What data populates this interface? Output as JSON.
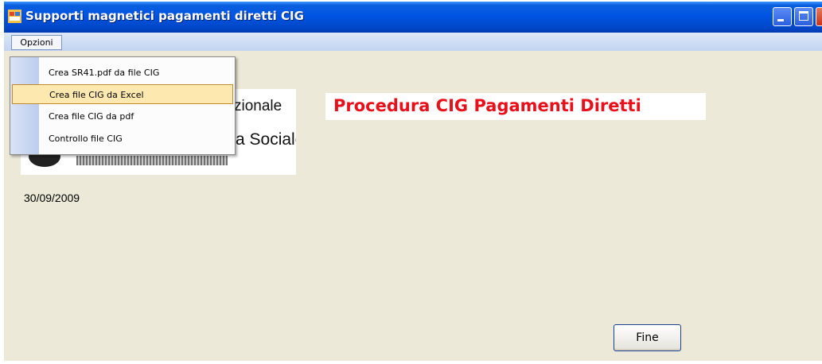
{
  "window": {
    "title": "Supporti magnetici pagamenti diretti  CIG"
  },
  "menubar": {
    "menu_label": "Opzioni"
  },
  "dropdown": {
    "items": [
      {
        "label": "Crea SR41.pdf da file CIG",
        "highlighted": false
      },
      {
        "label": "Crea file CIG da Excel",
        "highlighted": true
      },
      {
        "label": "Crea file CIG da pdf",
        "highlighted": false
      },
      {
        "label": "Controllo file CIG",
        "highlighted": false
      }
    ]
  },
  "logo": {
    "text_line1": "zionale",
    "text_line2": "a Sociale"
  },
  "main": {
    "heading": "Procedura CIG Pagamenti Diretti",
    "date": "30/09/2009",
    "fine_button_label": "Fine"
  },
  "colors": {
    "titlebar": "#0054e3",
    "window_background": "#ece9d8",
    "heading_text": "#e8101a",
    "menu_highlight": "#fde8b0"
  },
  "icons": {
    "app": "app-icon",
    "minimize": "minimize-icon",
    "maximize": "maximize-icon",
    "close": "close-icon"
  }
}
